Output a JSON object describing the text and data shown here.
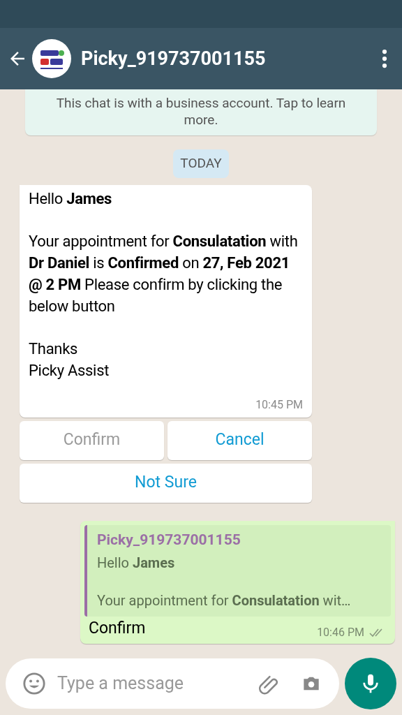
{
  "header": {
    "title": "Picky_919737001155"
  },
  "notice": "This chat is with a business account. Tap to learn more.",
  "date_chip": "TODAY",
  "incoming": {
    "paragraphs": [
      "Hello **James**",
      "Your appointment for **Consulatation** with **Dr Daniel** is **Confirmed** on **27, Feb 2021 @ 2 PM** Please confirm by clicking the below button",
      "Thanks\nPicky Assist"
    ],
    "time": "10:45 PM"
  },
  "quick_replies": [
    {
      "label": "Confirm",
      "disabled": true
    },
    {
      "label": "Cancel",
      "disabled": false
    },
    {
      "label": "Not Sure",
      "disabled": false
    }
  ],
  "outgoing": {
    "quote": {
      "author": "Picky_919737001155",
      "line_1": "Hello **James**",
      "line_2": "Your appointment for **Consulatation** wit…"
    },
    "text": "Confirm",
    "time": "10:46 PM",
    "read": false
  },
  "composer": {
    "placeholder": "Type a message"
  }
}
